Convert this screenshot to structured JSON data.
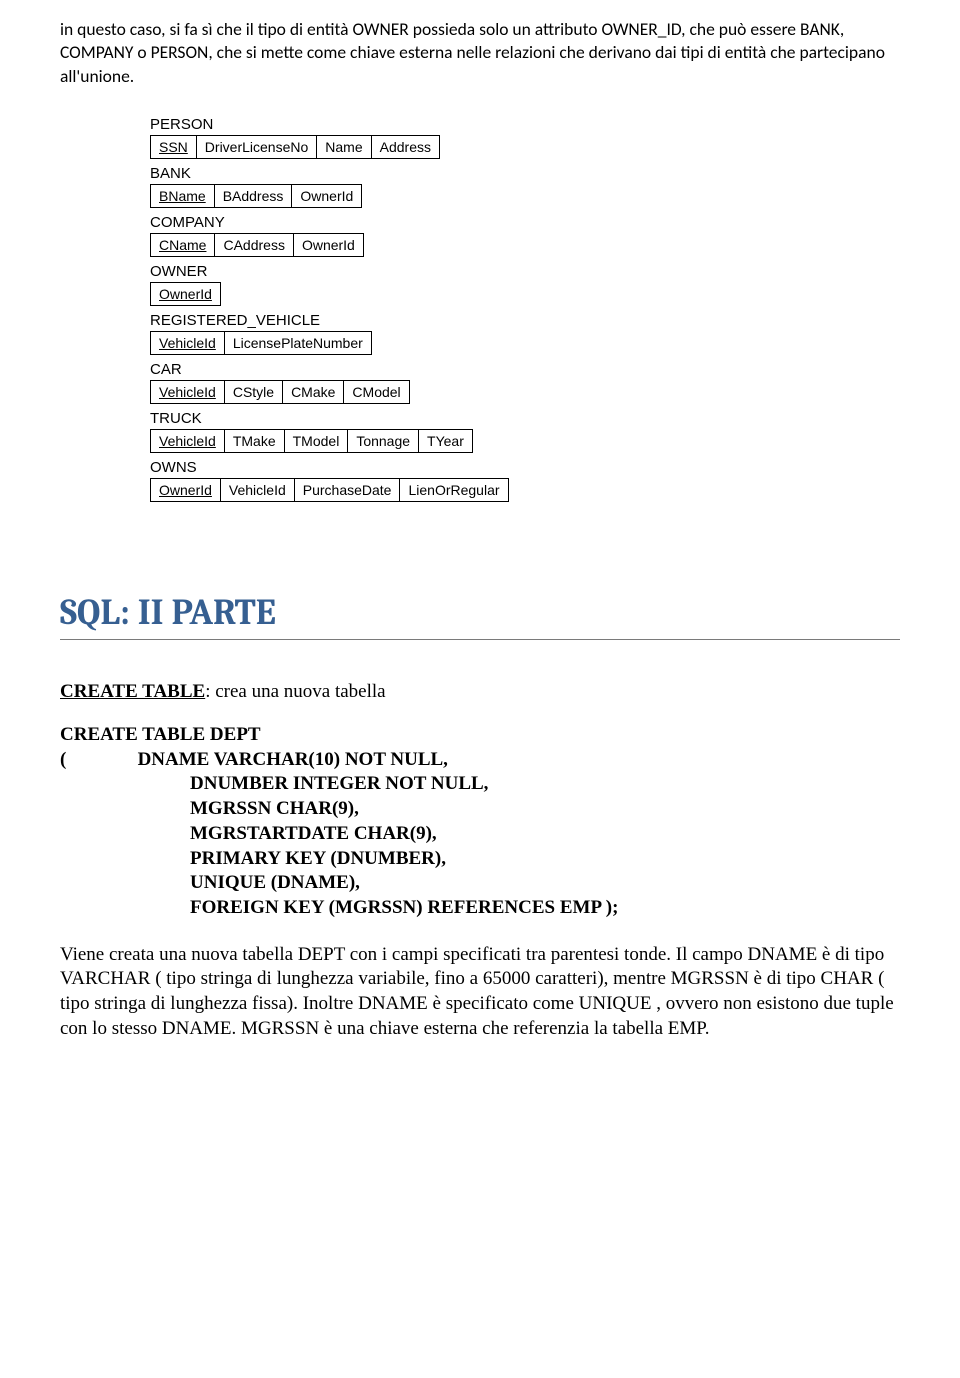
{
  "intro": "in questo caso, si fa sì che il tipo di entità OWNER possieda solo un attributo OWNER_ID, che può essere BANK, COMPANY o PERSON, che si mette come chiave esterna nelle relazioni che derivano dai tipi di entità che partecipano all'unione.",
  "schema": [
    {
      "name": "PERSON",
      "cols": [
        {
          "t": "SSN",
          "pk": true
        },
        {
          "t": "DriverLicenseNo"
        },
        {
          "t": "Name"
        },
        {
          "t": "Address"
        }
      ]
    },
    {
      "name": "BANK",
      "cols": [
        {
          "t": "BName",
          "pk": true
        },
        {
          "t": "BAddress"
        },
        {
          "t": "OwnerId"
        }
      ]
    },
    {
      "name": "COMPANY",
      "cols": [
        {
          "t": "CName",
          "pk": true
        },
        {
          "t": "CAddress"
        },
        {
          "t": "OwnerId"
        }
      ]
    },
    {
      "name": "OWNER",
      "cols": [
        {
          "t": "OwnerId",
          "pk": true
        }
      ]
    },
    {
      "name": "REGISTERED_VEHICLE",
      "cols": [
        {
          "t": "VehicleId",
          "pk": true
        },
        {
          "t": "LicensePlateNumber"
        }
      ]
    },
    {
      "name": "CAR",
      "cols": [
        {
          "t": "VehicleId",
          "pk": true
        },
        {
          "t": "CStyle"
        },
        {
          "t": "CMake"
        },
        {
          "t": "CModel"
        }
      ]
    },
    {
      "name": "TRUCK",
      "cols": [
        {
          "t": "VehicleId",
          "pk": true
        },
        {
          "t": "TMake"
        },
        {
          "t": "TModel"
        },
        {
          "t": "Tonnage"
        },
        {
          "t": "TYear"
        }
      ]
    },
    {
      "name": "OWNS",
      "cols": [
        {
          "t": "OwnerId",
          "pk": true
        },
        {
          "t": "VehicleId"
        },
        {
          "t": "PurchaseDate"
        },
        {
          "t": "LienOrRegular"
        }
      ]
    }
  ],
  "heading": "SQL: II PARTE",
  "create_table_label": "CREATE  TABLE",
  "create_table_desc": ": crea una nuova tabella",
  "code": {
    "l1": "CREATE TABLE DEPT",
    "l2a": "(",
    "l2b": "DNAME VARCHAR(10) NOT NULL,",
    "l3": "DNUMBER INTEGER NOT NULL,",
    "l4": "MGRSSN CHAR(9),",
    "l5": "MGRSTARTDATE CHAR(9),",
    "l6": "PRIMARY KEY (DNUMBER),",
    "l7": "UNIQUE (DNAME),",
    "l8": "FOREIGN KEY (MGRSSN) REFERENCES EMP );"
  },
  "explain": "Viene  creata una nuova tabella DEPT con i campi specificati tra parentesi tonde. Il campo DNAME è di tipo VARCHAR ( tipo stringa di lunghezza variabile, fino a 65000 caratteri), mentre MGRSSN è di tipo CHAR ( tipo stringa di lunghezza fissa). Inoltre DNAME è specificato come UNIQUE , ovvero non esistono due tuple con lo stesso DNAME. MGRSSN è una chiave esterna che referenzia la tabella EMP."
}
